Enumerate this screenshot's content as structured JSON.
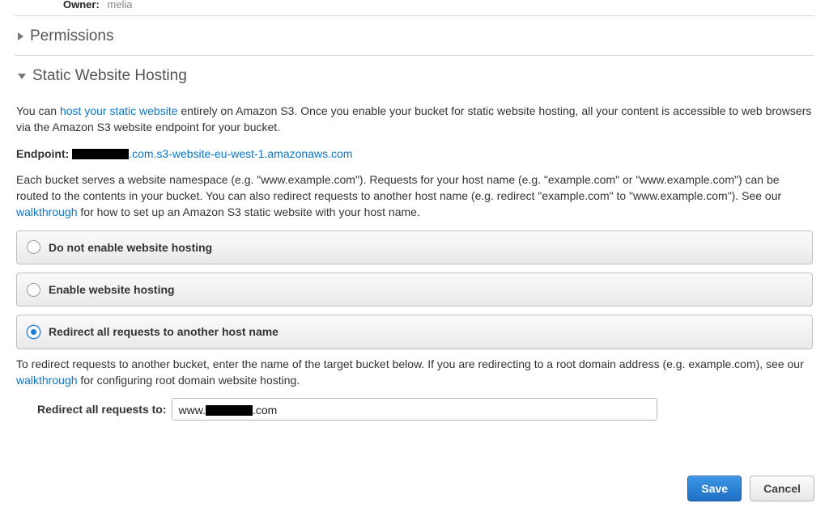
{
  "owner": {
    "label": "Owner:",
    "value": "melia"
  },
  "sections": {
    "permissions": {
      "title": "Permissions",
      "expanded": false
    },
    "static_hosting": {
      "title": "Static Website Hosting",
      "expanded": true
    }
  },
  "static_hosting": {
    "intro_pre": "You can ",
    "intro_link": "host your static website",
    "intro_post": " entirely on Amazon S3. Once you enable your bucket for static website hosting, all your content is accessible to web browsers via the Amazon S3 website endpoint for your bucket.",
    "endpoint_label": "Endpoint:",
    "endpoint_visible_suffix": ".com.s3-website-eu-west-1.amazonaws.com",
    "namespace_pre": "Each bucket serves a website namespace (e.g. \"www.example.com\"). Requests for your host name (e.g. \"example.com\" or \"www.example.com\") can be routed to the contents in your bucket. You can also redirect requests to another host name (e.g. redirect \"example.com\" to \"www.example.com\"). See our ",
    "namespace_link": "walkthrough",
    "namespace_post": " for how to set up an Amazon S3 static website with your host name.",
    "options": [
      {
        "id": "disable",
        "label": "Do not enable website hosting",
        "selected": false
      },
      {
        "id": "enable",
        "label": "Enable website hosting",
        "selected": false
      },
      {
        "id": "redirect",
        "label": "Redirect all requests to another host name",
        "selected": true
      }
    ],
    "redirect": {
      "desc_pre": "To redirect requests to another bucket, enter the name of the target bucket below. If you are redirecting to a root domain address (e.g. example.com), see our ",
      "desc_link": "walkthrough",
      "desc_post": " for configuring root domain website hosting.",
      "field_label": "Redirect all requests to:",
      "value_prefix": "www.",
      "value_suffix": ".com"
    }
  },
  "buttons": {
    "save": "Save",
    "cancel": "Cancel"
  }
}
